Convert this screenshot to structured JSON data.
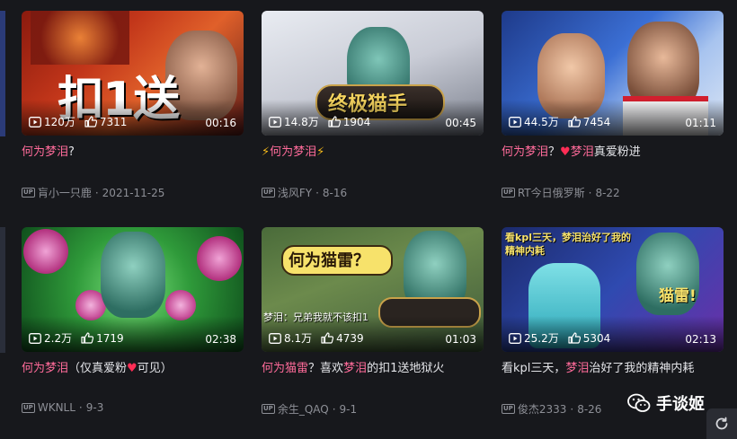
{
  "colors": {
    "accent": "#ff6b9a",
    "heart": "#ff2d55",
    "bg": "#17181c"
  },
  "cards": [
    {
      "views": "120万",
      "likes": "7311",
      "duration": "00:16",
      "thumb_text": "扣1送",
      "title": [
        {
          "t": "何为梦泪",
          "hl": true
        },
        {
          "t": "?"
        }
      ],
      "author": "肓小一只鹿",
      "date": "2021-11-25"
    },
    {
      "views": "14.8万",
      "likes": "1904",
      "duration": "00:45",
      "thumb_text": "终极猫手",
      "title": [
        {
          "t": "⚡",
          "bolt": true
        },
        {
          "t": "何为梦泪",
          "hl": true
        },
        {
          "t": "⚡",
          "bolt": true
        }
      ],
      "author": "浅风FY",
      "date": "8-16"
    },
    {
      "views": "44.5万",
      "likes": "7454",
      "duration": "01:11",
      "thumb_text": "",
      "title": [
        {
          "t": "何为梦泪",
          "hl": true
        },
        {
          "t": "？"
        },
        {
          "t": "♥",
          "heart": true
        },
        {
          "t": "梦泪",
          "hl": true
        },
        {
          "t": "真爱粉进"
        }
      ],
      "author": "RT今日俄罗斯",
      "date": "8-22"
    },
    {
      "views": "2.2万",
      "likes": "1719",
      "duration": "02:38",
      "thumb_text": "",
      "title": [
        {
          "t": "何为梦泪",
          "hl": true
        },
        {
          "t": "（仅真爱粉"
        },
        {
          "t": "♥",
          "heart": true
        },
        {
          "t": "可见）"
        }
      ],
      "author": "WKNLL",
      "date": "9-3"
    },
    {
      "views": "8.1万",
      "likes": "4739",
      "duration": "01:03",
      "thumb_text": "何为猫雷？",
      "thumb_sub": "梦泪：兄弟我就不该扣1",
      "title": [
        {
          "t": "何为",
          "hl": false
        },
        {
          "t": "猫雷",
          "hl": true
        },
        {
          "t": "？喜欢"
        },
        {
          "t": "梦泪",
          "hl": true
        },
        {
          "t": "的扣1送地狱火"
        }
      ],
      "author": "余生_QAQ",
      "date": "9-1"
    },
    {
      "views": "25.2万",
      "likes": "5304",
      "duration": "02:13",
      "thumb_text": "看kpl三天，梦泪治好了我的精神内耗",
      "thumb_sub": "猫雷!",
      "title": [
        {
          "t": "看kpl三天，"
        },
        {
          "t": "梦泪",
          "hl": true
        },
        {
          "t": "治好了我的精神内耗"
        }
      ],
      "author": "俊杰2333",
      "date": "8-26"
    }
  ],
  "up_label": "UP",
  "watermark": "手谈姬",
  "icons": {
    "play": "play-count-icon",
    "like": "like-icon",
    "refresh": "refresh-icon",
    "wechat": "wechat-icon"
  }
}
